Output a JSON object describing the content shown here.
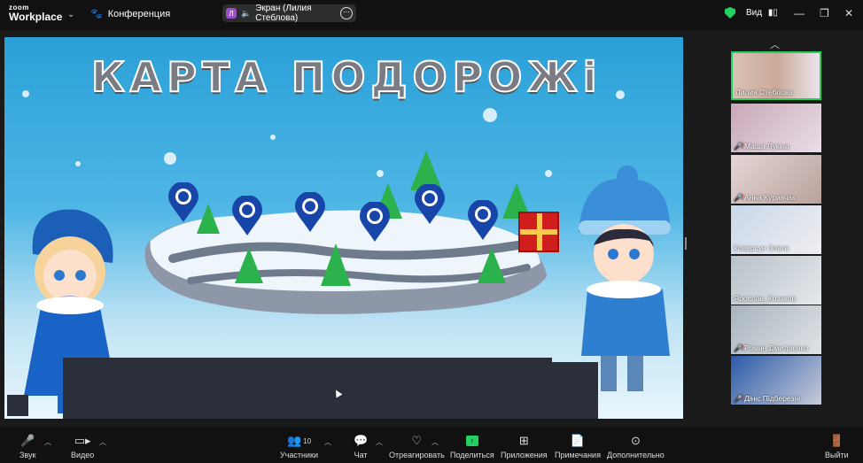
{
  "topbar": {
    "logo_line1": "zoom",
    "logo_line2": "Workplace",
    "conference_label": "Конференция",
    "share_avatar_letter": "Л",
    "share_label": "Экран (Лилия Стеблова)",
    "view_label": "Вид"
  },
  "slide": {
    "title": "КАРТА ПОДОРОЖі"
  },
  "participants": [
    {
      "name": "Лилия Стеблова",
      "muted": false,
      "active": true
    },
    {
      "name": "Маша Лукіна",
      "muted": true,
      "active": false
    },
    {
      "name": "Анна Куривчак",
      "muted": true,
      "active": false
    },
    {
      "name": "Коверсун Злата",
      "muted": false,
      "active": false
    },
    {
      "name": "Ярослав_Козаков",
      "muted": false,
      "active": false
    },
    {
      "name": "Роман Дмитрієнко",
      "muted": true,
      "active": false
    },
    {
      "name": "Дініс Підберезні",
      "muted": true,
      "active": false
    }
  ],
  "toolbar": {
    "audio": "Звук",
    "video": "Видео",
    "participants": "Участники",
    "participants_count": "10",
    "chat": "Чат",
    "react": "Отреагировать",
    "share": "Поделиться",
    "apps": "Приложения",
    "notes": "Примечания",
    "more": "Дополнительно",
    "leave": "Выйти"
  },
  "colors": {
    "accent_green": "#23d160",
    "mute_red": "#e33333",
    "share_pill": "#2d2d2d"
  }
}
